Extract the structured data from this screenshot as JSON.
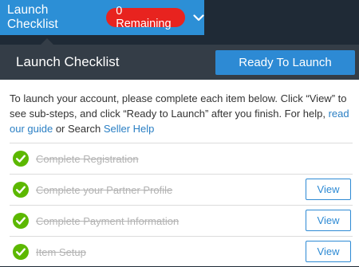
{
  "topbar": {
    "title": "Launch Checklist",
    "badge": "0 Remaining",
    "accent": "#2c8fd6",
    "badge_color": "#e8231f",
    "chevron_icon": "chevron-down-icon"
  },
  "panel": {
    "title": "Launch Checklist",
    "launch_button": "Ready To Launch",
    "intro": {
      "text1": "To launch your account, please complete each item below. Click “View” to see sub-steps, and click “Ready to Launch” after you finish. For help, ",
      "link1": "read our guide",
      "text2": " or Search ",
      "link2": "Seller Help"
    },
    "items": [
      {
        "label": "Complete Registration",
        "completed": true,
        "has_view": false
      },
      {
        "label": "Complete your Partner Profile",
        "completed": true,
        "has_view": true,
        "view_label": "View"
      },
      {
        "label": "Complete Payment Information",
        "completed": true,
        "has_view": true,
        "view_label": "View"
      },
      {
        "label": "Item Setup",
        "completed": true,
        "has_view": true,
        "view_label": "View"
      }
    ],
    "check_icon": "check-circle-icon",
    "check_color": "#5cb800"
  }
}
